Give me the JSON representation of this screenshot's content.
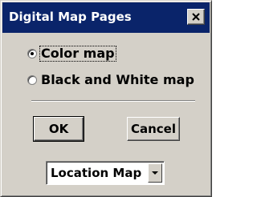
{
  "window": {
    "title": "Digital Map Pages"
  },
  "options": [
    {
      "label": "Color map",
      "selected": true
    },
    {
      "label": "Black and White map",
      "selected": false
    }
  ],
  "buttons": {
    "ok_label": "OK",
    "cancel_label": "Cancel"
  },
  "map_select": {
    "value": "Location Map"
  },
  "colors": {
    "titlebar": "#0a246a",
    "face": "#d4d0c8"
  },
  "icons": {
    "close": "close-icon",
    "dropdown": "chevron-down-icon"
  }
}
